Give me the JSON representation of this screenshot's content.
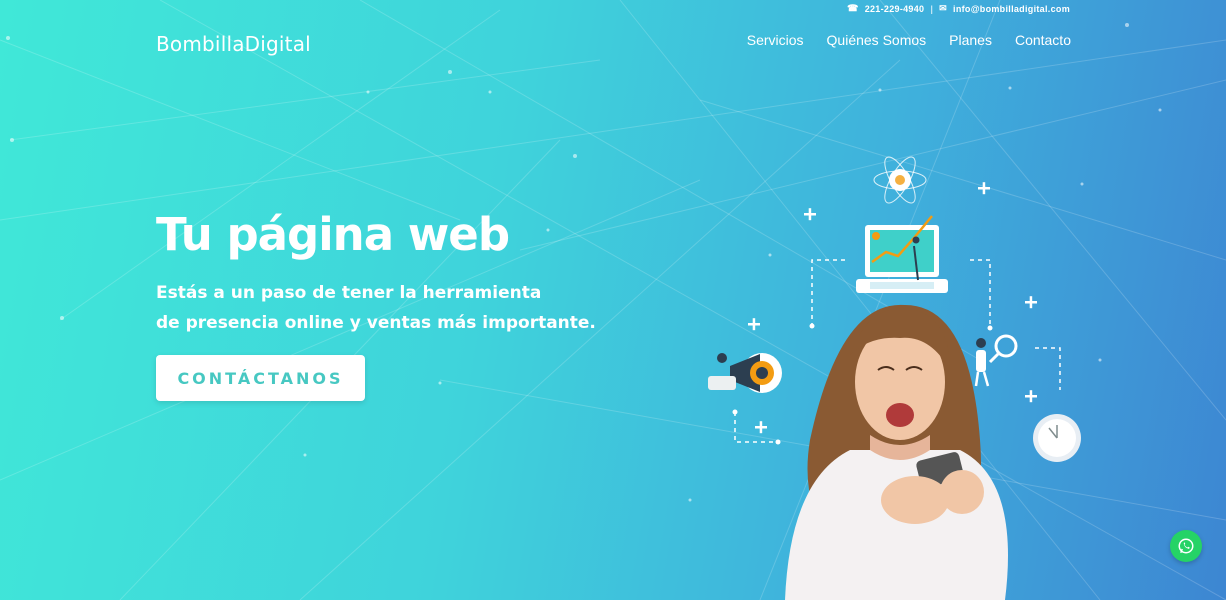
{
  "topbar": {
    "phone": "221-229-4940",
    "separator": "|",
    "email": "info@bombilladigital.com",
    "phone_icon": "phone-icon",
    "email_icon": "envelope-icon"
  },
  "header": {
    "logo_part1": "Bombilla",
    "logo_part2": "Digital",
    "nav": [
      "Servicios",
      "Quiénes Somos",
      "Planes",
      "Contacto"
    ]
  },
  "hero": {
    "title": "Tu página web",
    "subtitle_line1": "Estás a un paso de tener la herramienta",
    "subtitle_line2": "de presencia online y ventas más importante.",
    "cta_label": "CONTÁCTANOS"
  },
  "floating": {
    "whatsapp_icon": "whatsapp-icon"
  },
  "colors": {
    "gradient_start": "#40e8d8",
    "gradient_end": "#3d86d2",
    "cta_text": "#47c8c2",
    "whatsapp": "#25d366"
  }
}
